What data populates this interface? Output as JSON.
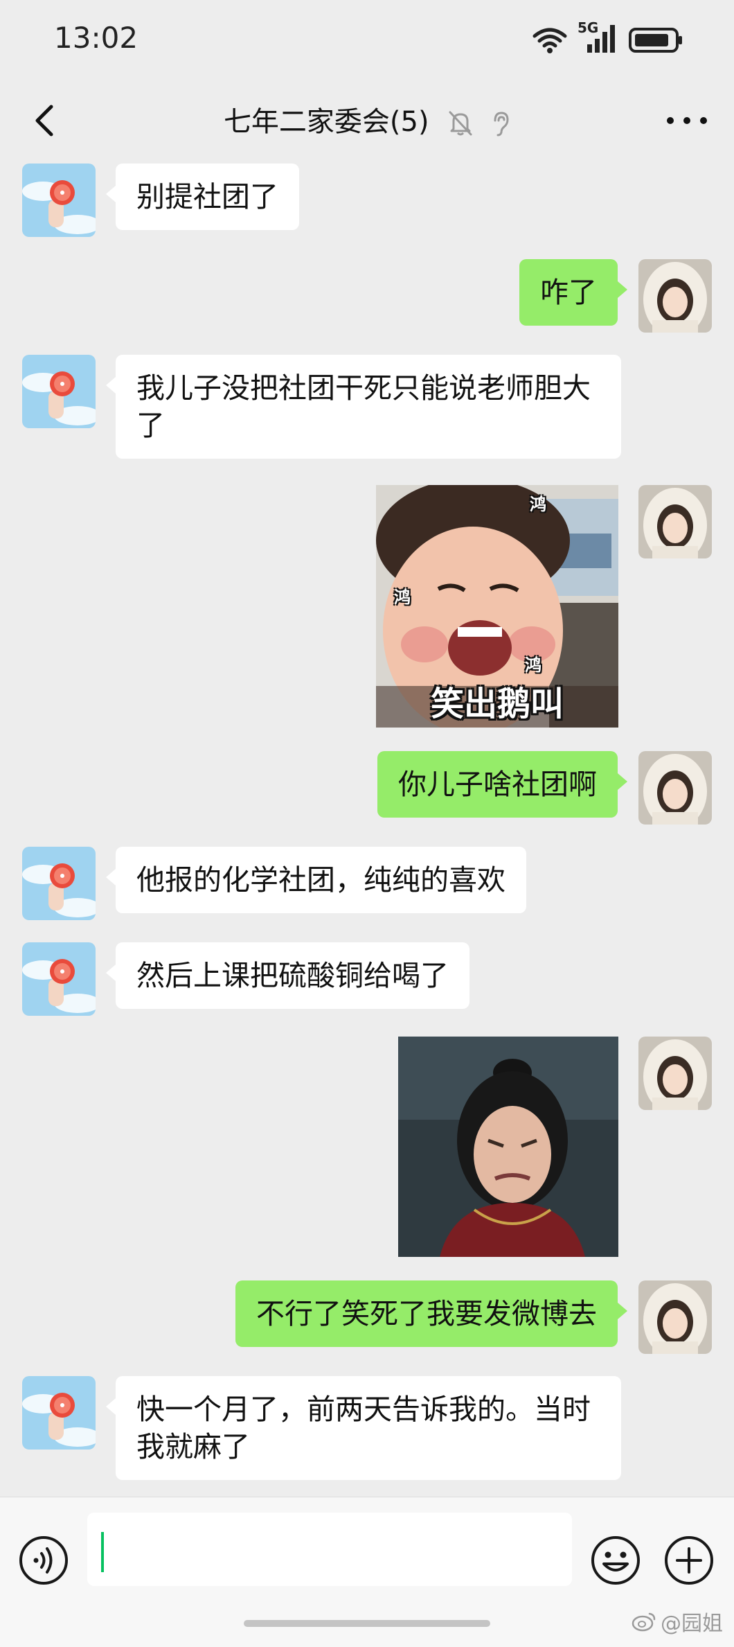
{
  "status_bar": {
    "time": "13:02",
    "network": "5G",
    "icons": [
      "wifi-icon",
      "signal-icon",
      "battery-icon"
    ]
  },
  "header": {
    "title": "七年二家委会(5)",
    "icons": [
      "back-icon",
      "mute-bell-icon",
      "earpiece-icon",
      "more-icon"
    ]
  },
  "messages": [
    {
      "side": "left",
      "type": "text",
      "text": "别提社团了"
    },
    {
      "side": "right",
      "type": "text",
      "text": "咋了"
    },
    {
      "side": "left",
      "type": "text",
      "text": "我儿子没把社团干死只能说老师胆大了"
    },
    {
      "side": "right",
      "type": "sticker",
      "caption": "笑出鹅叫",
      "marks": [
        "鸿",
        "鸿",
        "鸿"
      ]
    },
    {
      "side": "right",
      "type": "text",
      "text": "你儿子啥社团啊"
    },
    {
      "side": "left",
      "type": "text",
      "text": "他报的化学社团，纯纯的喜欢"
    },
    {
      "side": "left",
      "type": "text",
      "text": "然后上课把硫酸铜给喝了"
    },
    {
      "side": "right",
      "type": "sticker",
      "caption": ""
    },
    {
      "side": "right",
      "type": "text",
      "text": "不行了笑死了我要发微博去"
    },
    {
      "side": "left",
      "type": "text",
      "text": "快一个月了，前两天告诉我的。当时我就麻了"
    }
  ],
  "input_bar": {
    "value": "",
    "icons": [
      "voice-icon",
      "emoji-icon",
      "plus-icon"
    ]
  },
  "watermark": "@园姐",
  "colors": {
    "background": "#ededed",
    "incoming_bubble": "#ffffff",
    "outgoing_bubble": "#95ec69",
    "cursor": "#07c160"
  }
}
